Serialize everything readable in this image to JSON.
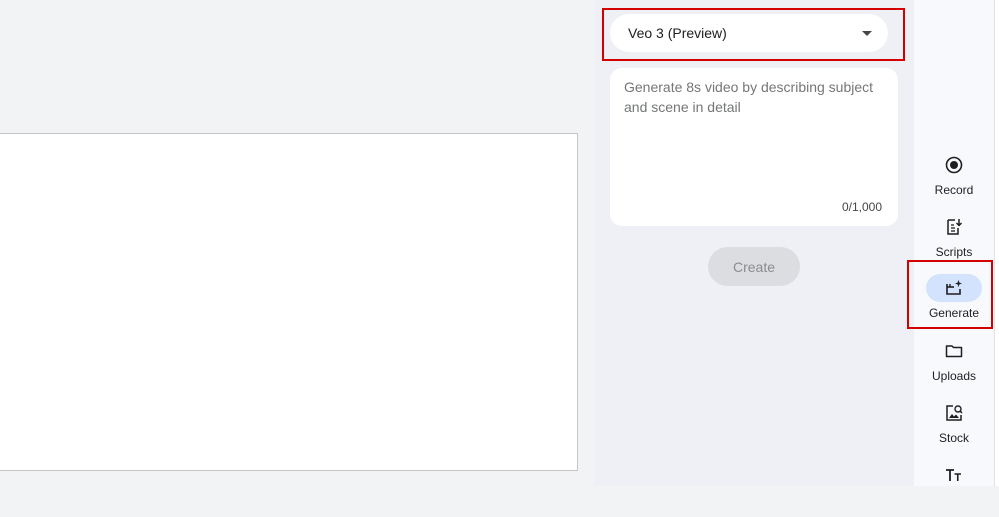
{
  "model_select": {
    "selected": "Veo 3 (Preview)"
  },
  "prompt": {
    "placeholder": "Generate 8s video by describing subject and scene in detail",
    "value": "",
    "char_count": "0/1,000"
  },
  "create_button": {
    "label": "Create"
  },
  "rail": {
    "items": [
      {
        "label": "Record",
        "icon": "record-icon"
      },
      {
        "label": "Scripts",
        "icon": "scripts-icon"
      },
      {
        "label": "Generate",
        "icon": "generate-icon"
      },
      {
        "label": "Uploads",
        "icon": "folder-icon"
      },
      {
        "label": "Stock",
        "icon": "stock-icon"
      },
      {
        "label": "",
        "icon": "text-icon"
      }
    ],
    "active": "Generate"
  },
  "colors": {
    "highlight": "#d40000",
    "active_pill": "#d3e3fd",
    "panel_bg": "#eef0f6"
  }
}
